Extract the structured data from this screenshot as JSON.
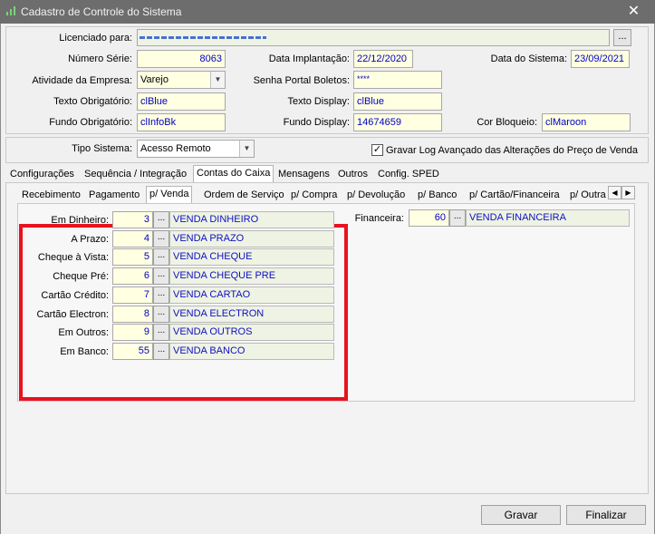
{
  "window": {
    "title": "Cadastro de Controle do Sistema",
    "close_glyph": "✕",
    "icon": "chart-app-icon"
  },
  "header": {
    "licenciado_label": "Licenciado para:",
    "licenciado_value": "",
    "licenciado_btn": "...",
    "numero_serie_label": "Número Série:",
    "numero_serie_value": "8063",
    "data_implantacao_label": "Data Implantação:",
    "data_implantacao_value": "22/12/2020",
    "data_sistema_label": "Data do Sistema:",
    "data_sistema_value": "23/09/2021",
    "atividade_label": "Atividade da Empresa:",
    "atividade_value": "Varejo",
    "senha_label": "Senha Portal Boletos:",
    "senha_value": "****",
    "texto_obrig_label": "Texto Obrigatório:",
    "texto_obrig_value": "clBlue",
    "texto_display_label": "Texto Display:",
    "texto_display_value": "clBlue",
    "fundo_obrig_label": "Fundo Obrigatório:",
    "fundo_obrig_value": "clInfoBk",
    "fundo_display_label": "Fundo Display:",
    "fundo_display_value": "14674659",
    "cor_bloqueio_label": "Cor Bloqueio:",
    "cor_bloqueio_value": "clMaroon"
  },
  "tipo": {
    "label": "Tipo Sistema:",
    "value": "Acesso Remoto",
    "gravar_log_label": "Gravar Log Avançado das Alterações do Preço de Venda",
    "gravar_log_checked": true
  },
  "main_tabs": [
    "Configurações",
    "Sequência / Integração",
    "Contas do Caixa",
    "Mensagens",
    "Outros",
    "Config. SPED"
  ],
  "main_tab_selected": "Contas do Caixa",
  "sub_tabs": [
    "Recebimento",
    "Pagamento",
    "p/ Venda",
    "Ordem de Serviço",
    "p/ Compra",
    "p/ Devolução",
    "p/ Banco",
    "p/ Cartão/Financeira",
    "p/ Outra"
  ],
  "sub_tab_selected": "p/ Venda",
  "accounts": [
    {
      "label": "Em Dinheiro:",
      "num": "3",
      "desc": "VENDA DINHEIRO"
    },
    {
      "label": "A Prazo:",
      "num": "4",
      "desc": "VENDA PRAZO"
    },
    {
      "label": "Cheque à Vista:",
      "num": "5",
      "desc": "VENDA CHEQUE"
    },
    {
      "label": "Cheque Pré:",
      "num": "6",
      "desc": "VENDA CHEQUE PRE"
    },
    {
      "label": "Cartão Crédito:",
      "num": "7",
      "desc": "VENDA CARTAO"
    },
    {
      "label": "Cartão Electron:",
      "num": "8",
      "desc": "VENDA ELECTRON"
    },
    {
      "label": "Em Outros:",
      "num": "9",
      "desc": "VENDA OUTROS"
    },
    {
      "label": "Em Banco:",
      "num": "55",
      "desc": "VENDA BANCO"
    }
  ],
  "dots": "...",
  "financeira": {
    "label": "Financeira:",
    "num": "60",
    "desc": "VENDA FINANCEIRA"
  },
  "footer": {
    "gravar": "Gravar",
    "finalizar": "Finalizar"
  },
  "colors": {
    "highlight": "#e8121e",
    "field_bg": "#ffffe1",
    "field_text": "#0000c8"
  }
}
